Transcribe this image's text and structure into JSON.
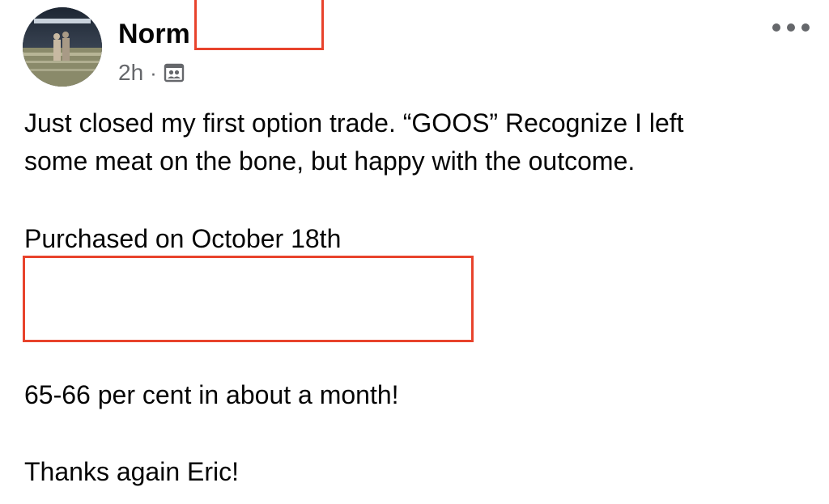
{
  "post": {
    "author": {
      "name": "Norm",
      "avatar": "profile-photo"
    },
    "meta": {
      "time": "2h",
      "separator": "·",
      "audience_icon": "friends-audience-icon"
    },
    "more_icon": "more-horizontal-icon",
    "body_lines": [
      "Just closed my first option trade. “GOOS” Recognize I left",
      "some meat on the bone, but happy with the outcome.",
      "Purchased on October 18th",
      "65-66 per cent in about a month!",
      "Thanks again Eric!"
    ]
  },
  "colors": {
    "redaction_border": "#e8432c",
    "text_primary": "#050505",
    "text_secondary": "#65676b"
  }
}
